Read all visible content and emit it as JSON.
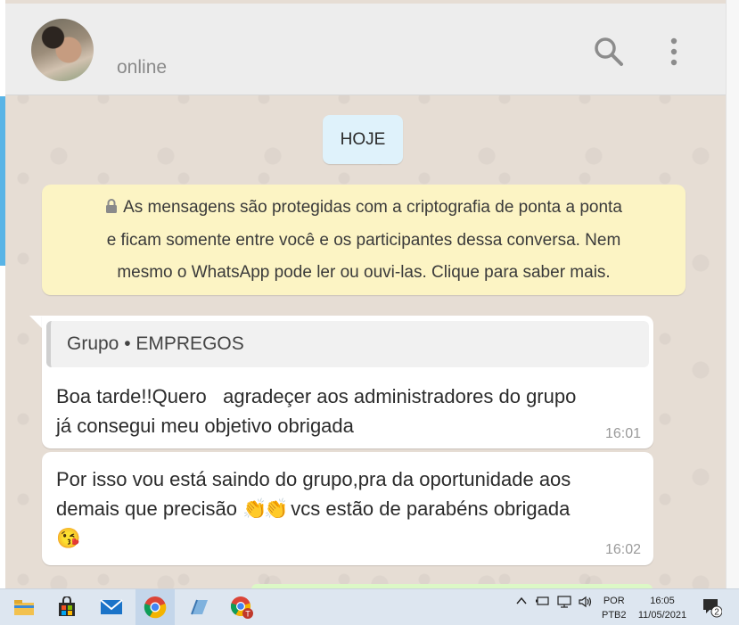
{
  "contact": {
    "status": "online"
  },
  "icons": {
    "search": "search-icon",
    "menu": "more-vert-icon",
    "lock": "lock-icon"
  },
  "date_divider": "HOJE",
  "encryption_notice": {
    "line1": "As mensagens são protegidas com a criptografia de ponta a ponta",
    "line2": "e ficam somente entre você e os participantes dessa conversa. Nem",
    "line3": "mesmo o WhatsApp pode ler ou ouvi-las. Clique para saber mais."
  },
  "messages": [
    {
      "quoted": "Grupo • EMPREGOS",
      "line1": "Boa tarde!!Quero   agradeçer aos administradores do grupo",
      "line2": "já consegui meu objetivo obrigada",
      "time": "16:01"
    },
    {
      "line1": "Por isso vou está saindo do grupo,pra da oportunidade aos",
      "line2_pre": "demais que precisão ",
      "emoji_clap": "👏",
      "line2_post": " vcs estão de parabéns obrigada",
      "emoji_kiss": "😘",
      "time": "16:02"
    }
  ],
  "taskbar": {
    "apps": [
      "file-explorer-icon",
      "store-icon",
      "mail-icon",
      "chrome-icon",
      "notepad-icon",
      "chrome-profile-icon"
    ],
    "language": {
      "line1": "POR",
      "line2": "PTB2"
    },
    "clock": {
      "time": "16:05",
      "date": "11/05/2021"
    },
    "notifications": "2"
  },
  "colors": {
    "chat_bg": "#e6ddd4",
    "notice_bg": "#fcf4c4",
    "date_bg": "#dff2fb",
    "bubble_bg": "#ffffff"
  }
}
